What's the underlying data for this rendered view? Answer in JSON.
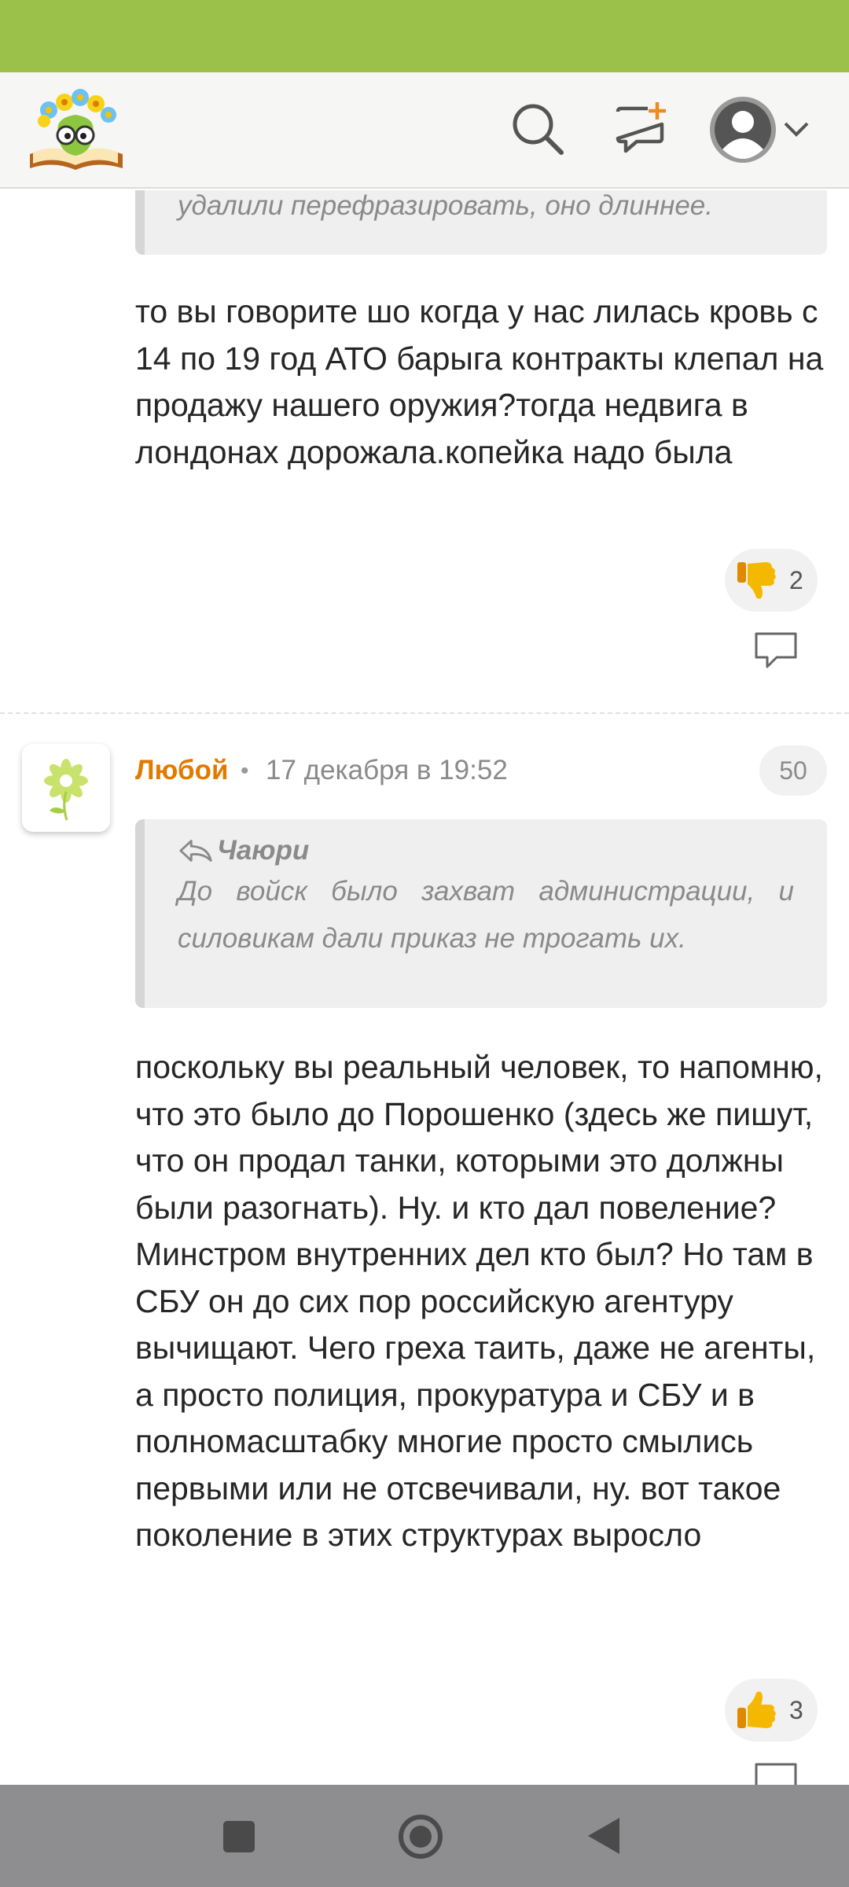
{
  "header": {
    "logo_icon": "book-flower-glasses-logo",
    "search_icon": "search-icon",
    "new_post_icon": "new-post-icon",
    "avatar_icon": "user-avatar-icon"
  },
  "colors": {
    "status_bar": "#9cc14a",
    "accent_orange": "#e07b00",
    "nav_bar": "#8e8e90"
  },
  "comment1": {
    "quote_text": "удалили перефразировать, оно длиннее.",
    "body": "то вы говорите шо когда у нас лилась кровь с 14 по 19 год АТО барыга контракты клепал на продажу нашего оружия?тогда недвига в лондонах дорожала.копейка надо была",
    "reaction_icon": "thumbs-down-icon",
    "reaction_count": "2"
  },
  "comment2": {
    "author": "Любой",
    "separator": "•",
    "date": "17 декабря в 19:52",
    "rating": "50",
    "quote_author": "Чаюри",
    "quote_text": "До войск было захват администрации, и силовикам дали приказ не трогать их.",
    "body": "поскольку вы реальный человек, то напомню, что это было до Порошенко (здесь же пишут, что он продал танки, которыми это должны были разогнать). Ну. и кто дал повеление? Минстром внутренних дел кто был? Но там в СБУ он до сих пор российскую агентуру вычищают. Чего греха таить, даже не агенты, а просто полиция, прокуратура и СБУ и в полномасштабку многие просто смылись первыми или не отсвечивали, ну. вот такое поколение в этих структурах выросло",
    "reaction_icon": "thumbs-up-icon",
    "reaction_count": "3"
  },
  "navbar": {
    "recent_icon": "square-recents-icon",
    "home_icon": "circle-home-icon",
    "back_icon": "triangle-back-icon"
  }
}
